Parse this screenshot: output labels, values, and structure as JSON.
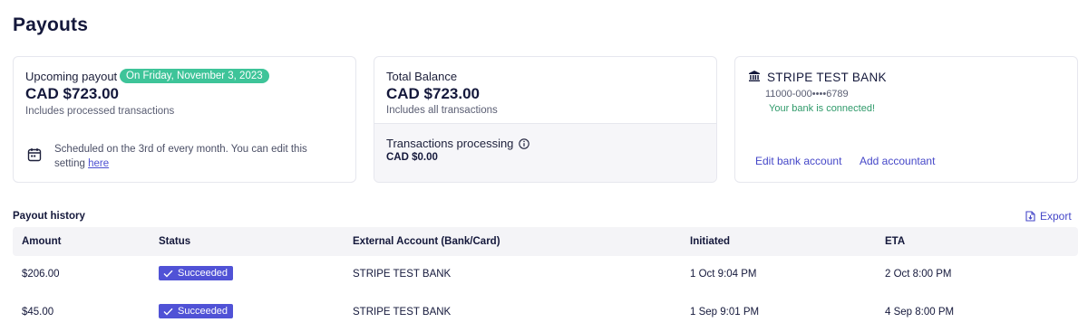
{
  "page": {
    "title": "Payouts"
  },
  "upcoming": {
    "label": "Upcoming payout",
    "date_badge": "On Friday, November 3, 2023",
    "amount": "CAD $723.00",
    "subtext": "Includes processed transactions",
    "schedule_text": "Scheduled on the 3rd of every month. You can edit this setting ",
    "schedule_link": "here",
    "icon": "calendar-icon"
  },
  "balance": {
    "label": "Total Balance",
    "amount": "CAD $723.00",
    "subtext": "Includes all transactions",
    "processing_label": "Transactions processing",
    "processing_amount": "CAD $0.00"
  },
  "bank": {
    "name": "STRIPE TEST BANK",
    "account": "11000-000••••6789",
    "connected_text": "Your bank is connected!",
    "edit_label": "Edit bank account",
    "add_label": "Add accountant",
    "icon": "bank-icon"
  },
  "history": {
    "title": "Payout history",
    "export_label": "Export",
    "columns": [
      "Amount",
      "Status",
      "External Account (Bank/Card)",
      "Initiated",
      "ETA"
    ],
    "rows": [
      {
        "amount": "$206.00",
        "status": "Succeeded",
        "account": "STRIPE TEST BANK",
        "initiated": "1 Oct 9:04 PM",
        "eta": "2 Oct 8:00 PM"
      },
      {
        "amount": "$45.00",
        "status": "Succeeded",
        "account": "STRIPE TEST BANK",
        "initiated": "1 Sep 9:01 PM",
        "eta": "4 Sep 8:00 PM"
      }
    ]
  },
  "colors": {
    "accent": "#5052d6",
    "badge_green": "#3ec499",
    "connected_green": "#2f9a6a",
    "link": "#4547c8"
  }
}
